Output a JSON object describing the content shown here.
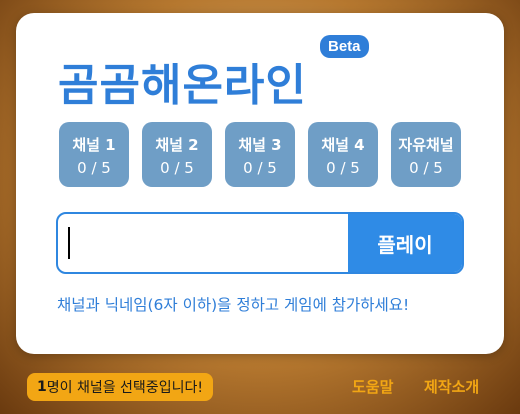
{
  "app": {
    "title": "곰곰해온라인",
    "badge": "Beta"
  },
  "channels": [
    {
      "name": "채널 1",
      "count": "0 / 5"
    },
    {
      "name": "채널 2",
      "count": "0 / 5"
    },
    {
      "name": "채널 3",
      "count": "0 / 5"
    },
    {
      "name": "채널 4",
      "count": "0 / 5"
    },
    {
      "name": "자유채널",
      "count": "0 / 5"
    }
  ],
  "form": {
    "nickname_value": "",
    "play_label": "플레이"
  },
  "hint": "채널과 닉네임(6자 이하)을 정하고 게임에 참가하세요!",
  "status": {
    "count": "1",
    "text": "명이 채널을 선택중입니다!"
  },
  "footer": {
    "help_label": "도움말",
    "credits_label": "제작소개"
  },
  "colors": {
    "accent": "#2f7ed8",
    "channel_bg": "#6f9ec6",
    "orange": "#f2a614"
  }
}
